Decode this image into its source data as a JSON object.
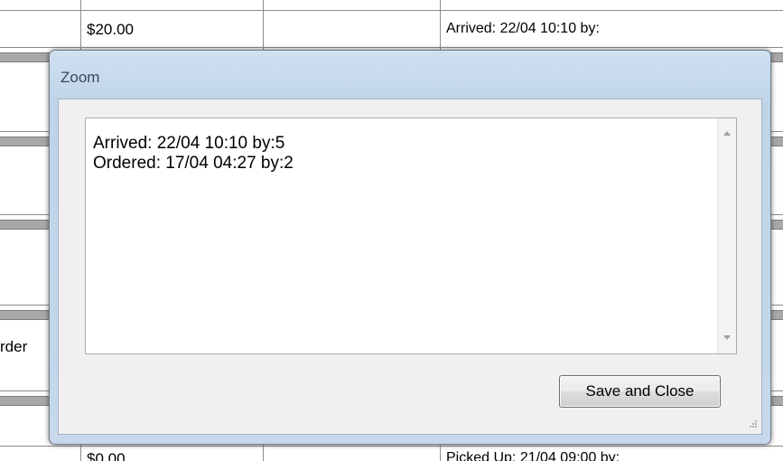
{
  "background_table": {
    "top_row": {
      "amount": "$20.00",
      "status": "Arrived: 22/04 10:10 by:"
    },
    "left_fragment": "rder",
    "bottom_row": {
      "amount": "$0.00",
      "status": "Picked Up: 21/04 09:00 by:"
    }
  },
  "dialog": {
    "title": "Zoom",
    "text_lines": [
      "Arrived: 22/04 10:10 by:5",
      "Ordered: 17/04 04:27 by:2"
    ],
    "save_button_label": "Save and Close"
  },
  "colors": {
    "dialog_frame": "#c6d8ea",
    "grid_band": "#a8a8a8",
    "client_area": "#f0f0f0"
  },
  "icons": [
    "scroll-up-icon",
    "scroll-down-icon",
    "resize-grip-icon"
  ]
}
